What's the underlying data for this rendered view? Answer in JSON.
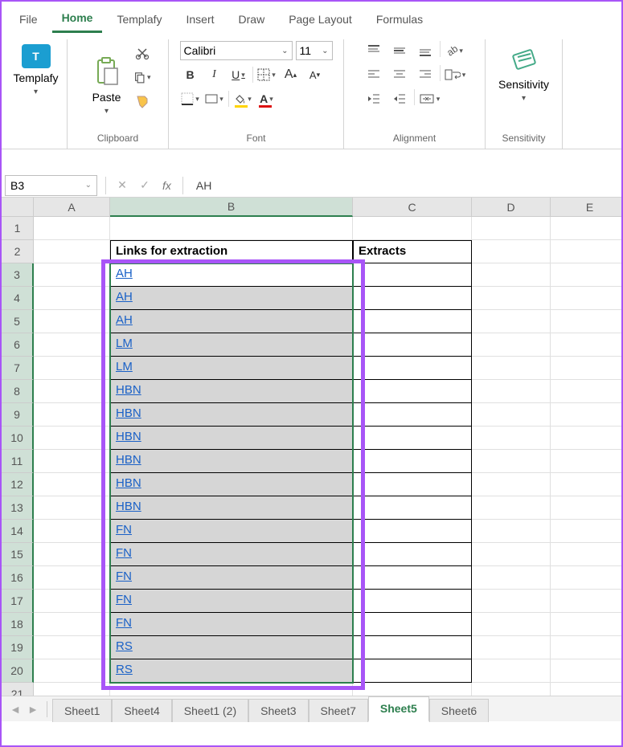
{
  "tabs": {
    "file": "File",
    "home": "Home",
    "templafy": "Templafy",
    "insert": "Insert",
    "draw": "Draw",
    "page_layout": "Page Layout",
    "formulas": "Formulas"
  },
  "ribbon": {
    "templafy": {
      "label": "Templafy"
    },
    "clipboard": {
      "paste": "Paste",
      "group": "Clipboard"
    },
    "font": {
      "name": "Calibri",
      "size": "11",
      "bold": "B",
      "italic": "I",
      "underline": "U",
      "group": "Font",
      "increase_a": "A",
      "decrease_a": "A"
    },
    "alignment": {
      "group": "Alignment"
    },
    "sensitivity": {
      "label": "Sensitivity",
      "group": "Sensitivity"
    }
  },
  "name_box": "B3",
  "formula_value": "AH",
  "fx_label": "fx",
  "columns": [
    "A",
    "B",
    "C",
    "D",
    "E"
  ],
  "rows": [
    "1",
    "2",
    "3",
    "4",
    "5",
    "6",
    "7",
    "8",
    "9",
    "10",
    "11",
    "12",
    "13",
    "14",
    "15",
    "16",
    "17",
    "18",
    "19",
    "20",
    "21"
  ],
  "headers": {
    "b2": "Links for extraction",
    "c2": "Extracts"
  },
  "links": [
    "AH",
    "AH",
    "AH",
    "LM",
    "LM",
    "HBN",
    "HBN",
    "HBN",
    "HBN",
    "HBN",
    "HBN",
    "FN",
    "FN",
    "FN",
    "FN",
    "FN",
    "RS",
    "RS"
  ],
  "sheet_tabs": [
    "Sheet1",
    "Sheet4",
    "Sheet1 (2)",
    "Sheet3",
    "Sheet7",
    "Sheet5",
    "Sheet6"
  ],
  "active_sheet": "Sheet5"
}
